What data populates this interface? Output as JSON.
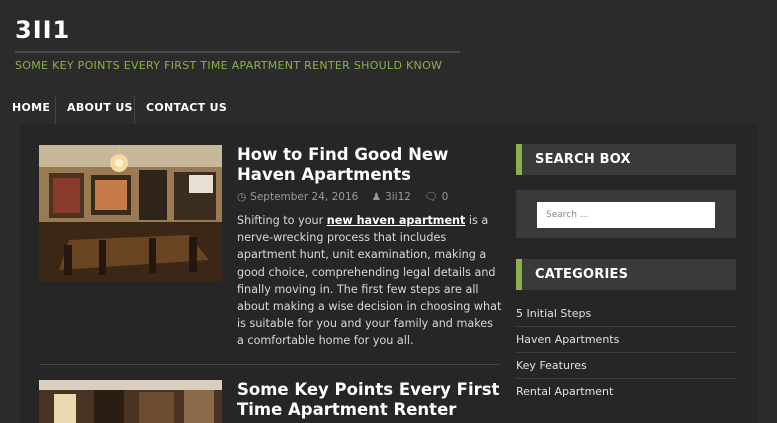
{
  "site": {
    "title": "3II1",
    "tagline": "SOME KEY POINTS EVERY FIRST TIME APARTMENT RENTER SHOULD KNOW"
  },
  "nav": {
    "items": [
      {
        "label": "HOME"
      },
      {
        "label": "ABOUT US"
      },
      {
        "label": "CONTACT US"
      }
    ]
  },
  "posts": [
    {
      "title": "How to Find Good New Haven Apartments",
      "date": "September 24, 2016",
      "author": "3ii12",
      "comments": "0",
      "excerpt_before": "Shifting to your ",
      "excerpt_link": "new haven apartment",
      "excerpt_after": " is a nerve-wrecking process that includes apartment hunt, unit examination, making a good choice, comprehending legal details and finally moving in. The first few steps are all about making a wise decision in choosing what is suitable for you and your family and makes a comfortable home for you all."
    },
    {
      "title": "Some Key Points Every First Time Apartment Renter"
    }
  ],
  "sidebar": {
    "search_title": "SEARCH BOX",
    "search_placeholder": "Search ...",
    "categories_title": "CATEGORIES",
    "categories": [
      {
        "label": "5 Initial Steps"
      },
      {
        "label": "Haven Apartments"
      },
      {
        "label": "Key Features"
      },
      {
        "label": "Rental Apartment"
      }
    ]
  },
  "colors": {
    "background": "#2b2b2b",
    "accent": "#8ab04a",
    "widget": "#3a3a3a"
  },
  "icons": {
    "date": "clock-icon",
    "author": "user-icon",
    "comments": "comment-icon"
  }
}
